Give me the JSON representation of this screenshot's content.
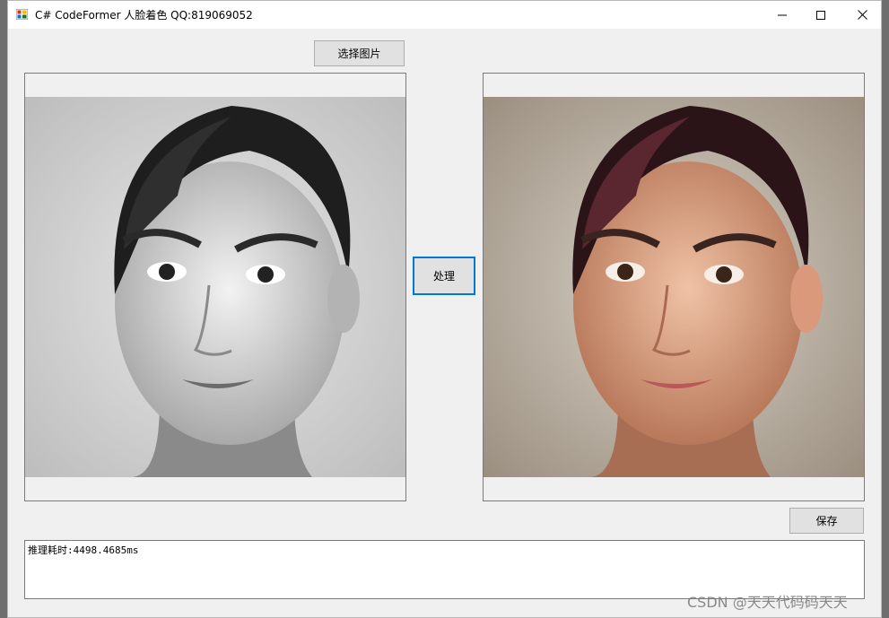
{
  "window": {
    "title": "C# CodeFormer 人脸着色 QQ:819069052",
    "icon": "winforms-app-icon",
    "controls": [
      "minimize-icon",
      "maximize-icon",
      "close-icon"
    ]
  },
  "buttons": {
    "select_image": "选择图片",
    "process": "处理",
    "save": "保存"
  },
  "images": {
    "input": "grayscale-portrait",
    "output": "colorized-portrait"
  },
  "log": {
    "text": "推理耗时:4498.4685ms"
  },
  "watermark": "CSDN @天天代码码天天",
  "colors": {
    "focus_border": "#0078d7",
    "window_bg": "#f0f0f0"
  }
}
